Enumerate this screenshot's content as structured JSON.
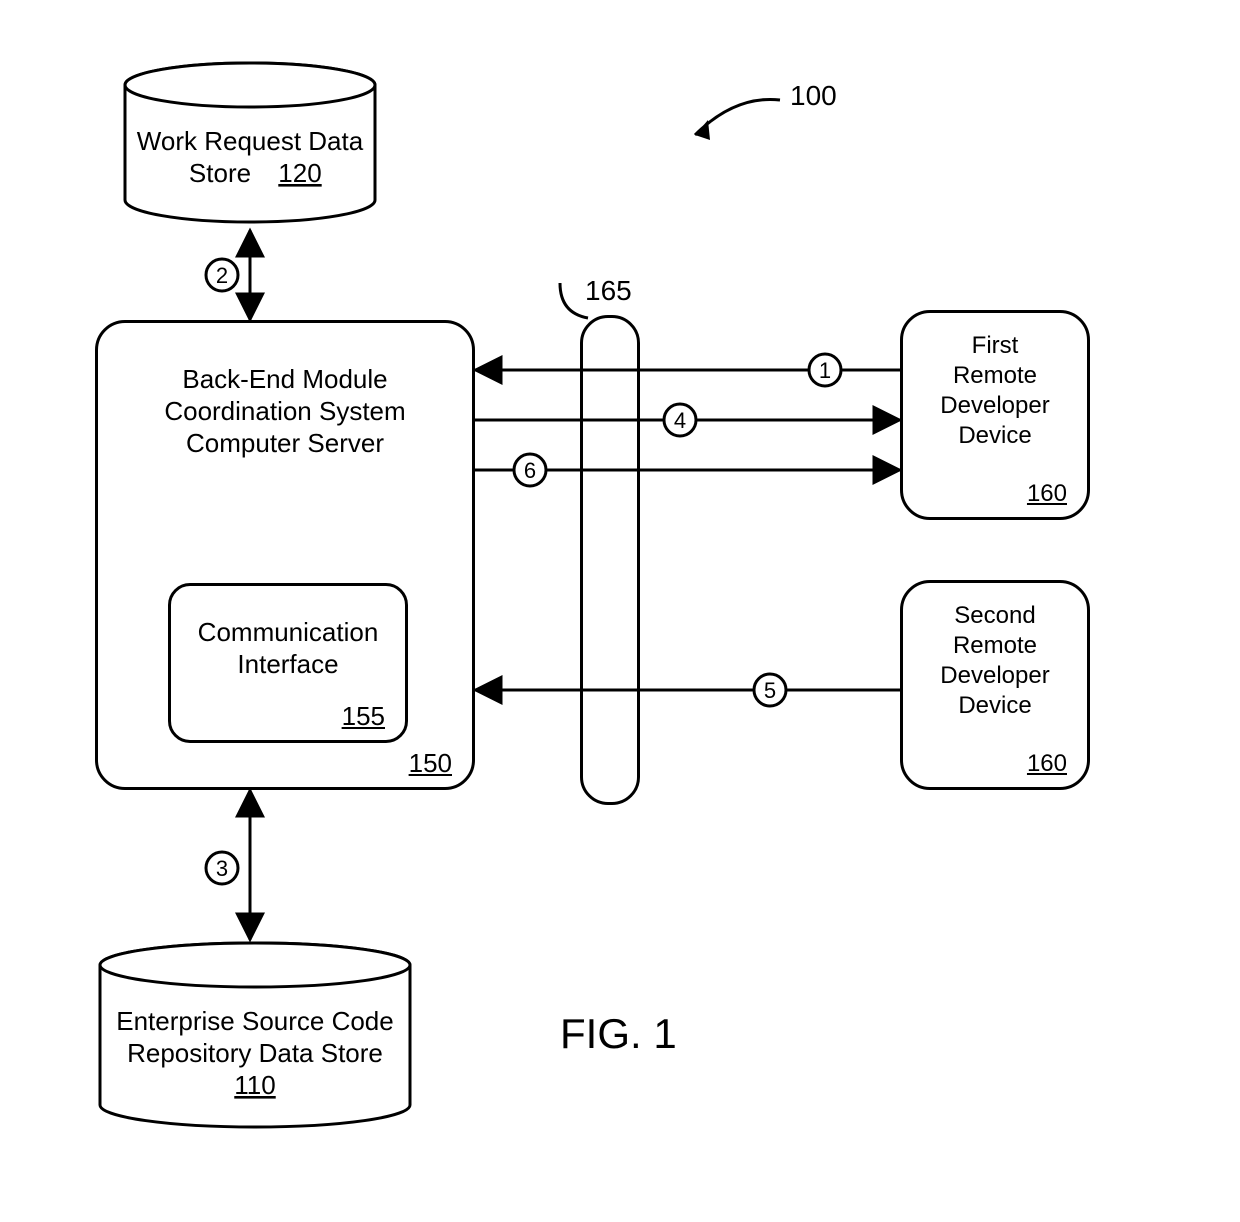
{
  "figure_label": "FIG. 1",
  "diagram_ref": "100",
  "firewall_ref": "165",
  "blocks": {
    "work_store": {
      "label_l1": "Work Request Data",
      "label_l2": "Store",
      "ref": "120"
    },
    "source_store": {
      "label_l1": "Enterprise Source Code",
      "label_l2": "Repository Data Store",
      "ref": "110"
    },
    "server": {
      "label_l1": "Back-End Module",
      "label_l2": "Coordination System",
      "label_l3": "Computer Server",
      "ref": "150"
    },
    "comm_if": {
      "label_l1": "Communication",
      "label_l2": "Interface",
      "ref": "155"
    },
    "dev1": {
      "label_l1": "First",
      "label_l2": "Remote",
      "label_l3": "Developer",
      "label_l4": "Device",
      "ref": "160"
    },
    "dev2": {
      "label_l1": "Second",
      "label_l2": "Remote",
      "label_l3": "Developer",
      "label_l4": "Device",
      "ref": "160"
    }
  },
  "steps": {
    "s1": "1",
    "s2": "2",
    "s3": "3",
    "s4": "4",
    "s5": "5",
    "s6": "6"
  }
}
